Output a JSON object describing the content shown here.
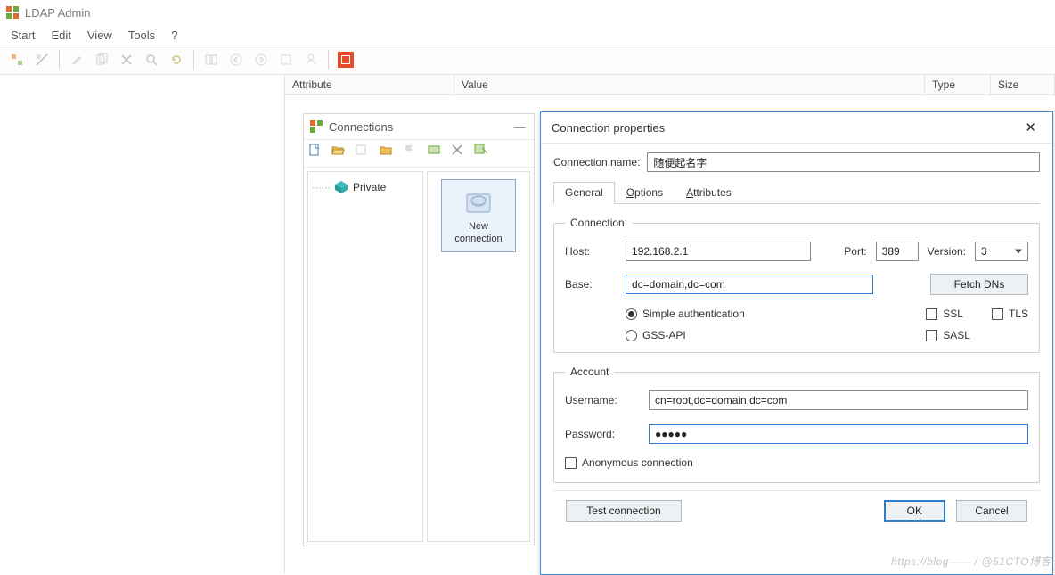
{
  "app": {
    "title": "LDAP Admin"
  },
  "menu": {
    "items": [
      "Start",
      "Edit",
      "View",
      "Tools",
      "?"
    ]
  },
  "columns": {
    "attribute": "Attribute",
    "value": "Value",
    "type": "Type",
    "size": "Size"
  },
  "conn_window": {
    "title": "Connections",
    "tree_item": "Private",
    "new_item_line1": "New",
    "new_item_line2": "connection"
  },
  "modal": {
    "title": "Connection properties",
    "conn_name_label": "Connection name:",
    "conn_name_value": "随便起名字",
    "tabs": {
      "general": "General",
      "options_pre": "O",
      "options_rest": "ptions",
      "attributes_pre": "A",
      "attributes_rest": "ttributes"
    },
    "connection_legend": "Connection:",
    "host_label": "Host:",
    "host_value": "192.168.2.1",
    "port_label": "Port:",
    "port_value": "389",
    "version_label": "Version:",
    "version_value": "3",
    "base_label": "Base:",
    "base_value": "dc=domain,dc=com",
    "fetch_dns": "Fetch DNs",
    "simple_auth": "Simple authentication",
    "gss_api": "GSS-API",
    "ssl": "SSL",
    "tls": "TLS",
    "sasl": "SASL",
    "account_legend": "Account",
    "username_label": "Username:",
    "username_value": "cn=root,dc=domain,dc=com",
    "password_label": "Password:",
    "password_value": "●●●●●",
    "anon": "Anonymous connection",
    "test": "Test connection",
    "ok": "OK",
    "cancel": "Cancel"
  },
  "watermark": "https://blog—— / @51CTO博客"
}
